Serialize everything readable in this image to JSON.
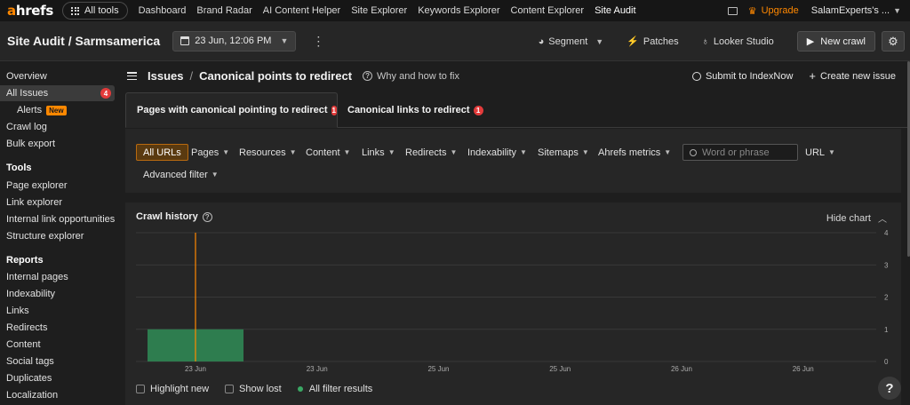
{
  "topnav": {
    "logo_a": "a",
    "logo_rest": "hrefs",
    "all_tools": "All tools",
    "items": [
      "Dashboard",
      "Brand Radar",
      "AI Content Helper",
      "Site Explorer",
      "Keywords Explorer",
      "Content Explorer",
      "Site Audit"
    ],
    "active_item": "Site Audit",
    "upgrade": "Upgrade",
    "account": "SalamExperts's ...",
    "accent_color": "#ff8800"
  },
  "project": {
    "title": "Site Audit / Sarmsamerica",
    "date": "23 Jun, 12:06 PM",
    "actions": {
      "segment": "Segment",
      "patches": "Patches",
      "looker": "Looker Studio",
      "new_crawl": "New crawl"
    }
  },
  "sidebar": {
    "overview": "Overview",
    "all_issues": "All Issues",
    "all_issues_count": "4",
    "alerts": "Alerts",
    "alerts_badge": "New",
    "crawl_log": "Crawl log",
    "bulk_export": "Bulk export",
    "tools_heading": "Tools",
    "tools": [
      "Page explorer",
      "Link explorer",
      "Internal link opportunities",
      "Structure explorer"
    ],
    "reports_heading": "Reports",
    "reports": [
      "Internal pages",
      "Indexability",
      "Links",
      "Redirects",
      "Content",
      "Social tags",
      "Duplicates",
      "Localization"
    ]
  },
  "issue": {
    "section": "Issues",
    "name": "Canonical points to redirect",
    "why": "Why and how to fix",
    "submit": "Submit to IndexNow",
    "create": "Create new issue"
  },
  "tabs": [
    {
      "label": "Pages with canonical pointing to redirect",
      "count": "1"
    },
    {
      "label": "Canonical links to redirect",
      "count": "1"
    }
  ],
  "filters": {
    "all_urls": "All URLs",
    "pages": "Pages",
    "resources": "Resources",
    "content": "Content",
    "links": "Links",
    "redirects": "Redirects",
    "indexability": "Indexability",
    "sitemaps": "Sitemaps",
    "ahrefs_metrics": "Ahrefs metrics",
    "search_placeholder": "Word or phrase",
    "url": "URL",
    "advanced": "Advanced filter"
  },
  "chart": {
    "title": "Crawl history",
    "hide_label": "Hide chart",
    "legend": {
      "highlight_new": "Highlight new",
      "show_lost": "Show lost",
      "all_filter": "All filter results"
    },
    "bar_color": "#2e7d4f",
    "marker_color": "#ff8800"
  },
  "chart_data": {
    "type": "bar",
    "categories": [
      "23 Jun",
      "23 Jun",
      "25 Jun",
      "25 Jun",
      "26 Jun",
      "26 Jun"
    ],
    "values": [
      1,
      0,
      0,
      0,
      0,
      0
    ],
    "ylim": [
      0,
      4
    ],
    "yticks": [
      0,
      1,
      2,
      3,
      4
    ],
    "grid": true,
    "series": [
      {
        "name": "All filter results",
        "values": [
          1,
          0,
          0,
          0,
          0,
          0
        ]
      }
    ]
  },
  "help": "?"
}
